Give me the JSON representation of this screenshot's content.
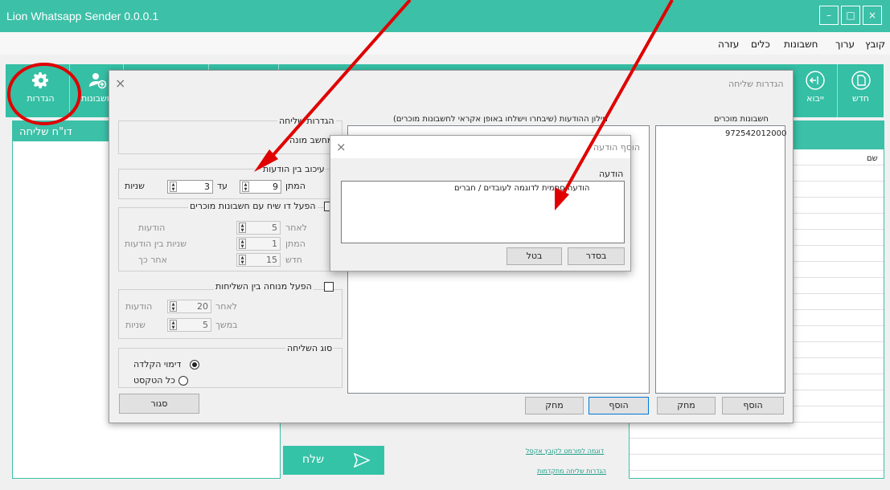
{
  "app": {
    "title": "Lion Whatsapp Sender 0.0.0.1",
    "window_controls": {
      "minimize": "–",
      "maximize": "□",
      "close": "×"
    }
  },
  "menu": [
    "קובץ",
    "ערוך",
    "חשבונות",
    "כלים",
    "עזרה"
  ],
  "toolbar": {
    "settings_label": "הגדרות",
    "accounts_label": "חשבונות",
    "new_label": "חדש",
    "import_label": "ייבוא"
  },
  "main": {
    "left_panel_header": "דו\"ח שליחה",
    "right_column_header": "שם",
    "send_label": "שלח",
    "link_excel": "דוגמה לפורמט לקובץ אקסל",
    "link_advanced": "הגדרות שליחה מתקדמות"
  },
  "settings_dialog": {
    "title": "הגדרות שליחה",
    "close": "×",
    "send_settings": {
      "label": "הגדרות שליחה",
      "counter": "מחשב מונה"
    },
    "delay": {
      "label": "עיכוב בין הודעות",
      "wait_label": "המתן",
      "wait_value": "9",
      "to_label": "עד",
      "to_value": "3",
      "unit": "שניות"
    },
    "dialogue": {
      "label": "הפעל דו שיח עם חשבונות מוכרים",
      "after_label": "לאחר",
      "after_value": "5",
      "after_unit": "הודעות",
      "wait_label": "המתן",
      "wait_value": "1",
      "wait_unit": "שניות בין הודעות",
      "renew_label": "חדש",
      "renew_value": "15",
      "renew_unit": "אחר כך"
    },
    "rest": {
      "label": "הפעל מנוחה בין השליחות",
      "after_label": "לאחר",
      "after_value": "20",
      "after_unit": "הודעות",
      "duration_label": "במשך",
      "duration_value": "5",
      "duration_unit": "שניות"
    },
    "send_type": {
      "label": "סוג השליחה",
      "option1": "דימוי הקלדה",
      "option2": "כל הטקסט"
    },
    "close_button": "סגור",
    "messages_pool_label": "מילון ההודעות (שיבחרו וישלחו באופן אקראי לחשבונות מוכרים)",
    "known_accounts_label": "חשבונות מוכרים",
    "known_accounts": [
      "972542012000"
    ],
    "add_button": "הוסף",
    "delete_button": "מחק",
    "add_button2": "הוסף",
    "delete_button2": "מחק"
  },
  "add_message_dialog": {
    "title": "הוסף הודעה",
    "close": "×",
    "message_label": "הודעה",
    "message_value": "הודעה סתמית לדוגמה לעובדים / חברים",
    "ok_button": "בסדר",
    "cancel_button": "בטל"
  },
  "colors": {
    "accent": "#3cc0a8",
    "annotation": "#e00000"
  }
}
